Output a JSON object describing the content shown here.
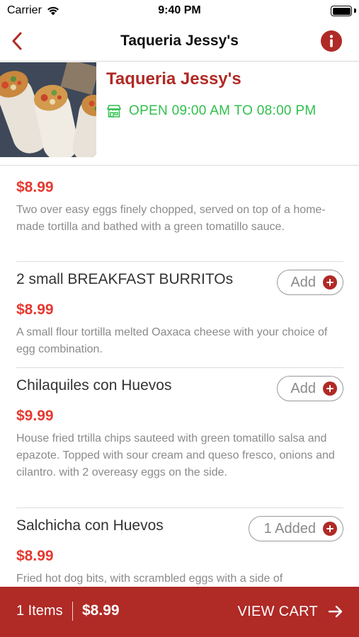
{
  "status_bar": {
    "carrier": "Carrier",
    "time": "9:40 PM"
  },
  "nav": {
    "title": "Taqueria Jessy's",
    "icons": {
      "back": "chevron-left-icon",
      "info": "info-icon"
    }
  },
  "restaurant": {
    "name": "Taqueria Jessy's",
    "hours": "OPEN 09:00 AM TO 08:00 PM",
    "hours_icon": "storefront-icon"
  },
  "menu_items": [
    {
      "name": "",
      "price": "$8.99",
      "description": "Two over easy eggs finely chopped, served on top of a home-made tortilla and bathed with a green tomatillo sauce.",
      "button_label": ""
    },
    {
      "name": "2 small BREAKFAST BURRITOs",
      "price": "$8.99",
      "description": "A small flour tortilla melted Oaxaca cheese with your choice of egg combination.",
      "button_label": "Add"
    },
    {
      "name": "Chilaquiles con Huevos",
      "price": "$9.99",
      "description": "House fried trtilla chips sauteed with green tomatillo salsa and epazote.  Topped with sour cream and queso fresco, onions and cilantro.  with 2 overeasy eggs on the side.",
      "button_label": "Add"
    },
    {
      "name": "Salchicha con Huevos",
      "price": "$8.99",
      "description": "Fried hot dog bits, with scrambled eggs with a side of",
      "button_label": "1 Added"
    }
  ],
  "cart": {
    "items": "1 Items",
    "total": "$8.99",
    "view_cart_label": "VIEW CART"
  },
  "colors": {
    "brand_red": "#b02a26",
    "price_red": "#e5392f",
    "open_green": "#2fbf4c"
  }
}
